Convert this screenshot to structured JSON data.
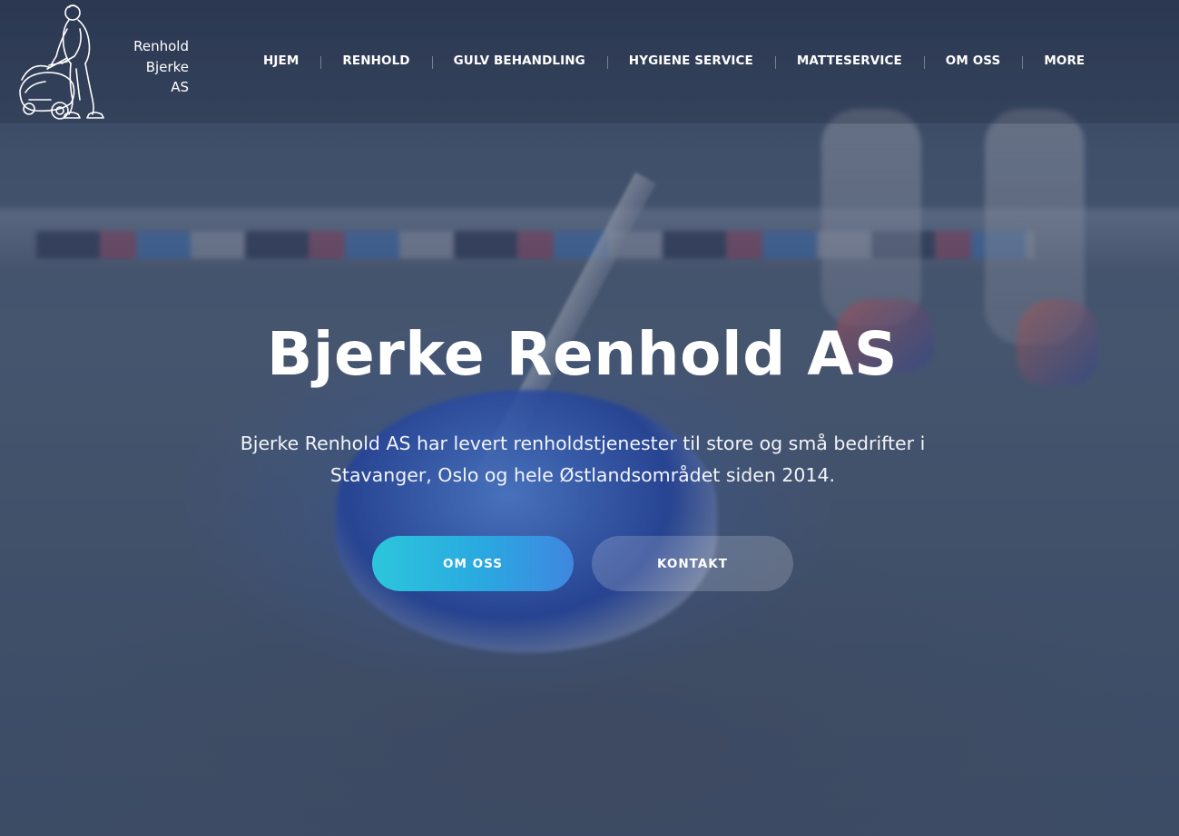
{
  "brand": {
    "name_lines": [
      "Renhold",
      "Bjerke",
      "AS"
    ],
    "logo_icon": "floor-scrubber-worker-icon"
  },
  "nav": {
    "items": [
      {
        "label": "HJEM"
      },
      {
        "label": "RENHOLD"
      },
      {
        "label": "GULV BEHANDLING"
      },
      {
        "label": "HYGIENE SERVICE"
      },
      {
        "label": "MATTESERVICE"
      },
      {
        "label": "OM OSS"
      },
      {
        "label": "MORE"
      }
    ]
  },
  "hero": {
    "title": "Bjerke Renhold AS",
    "subtitle": "Bjerke Renhold AS har levert renholdstjenester til store og små bedrifter i Stavanger, Oslo og hele Østlandsområdet siden 2014.",
    "primary_button": "OM OSS",
    "secondary_button": "KONTAKT"
  },
  "colors": {
    "primary_gradient_start": "#2cc6dc",
    "primary_gradient_end": "#3f87e0",
    "text": "#ffffff"
  }
}
